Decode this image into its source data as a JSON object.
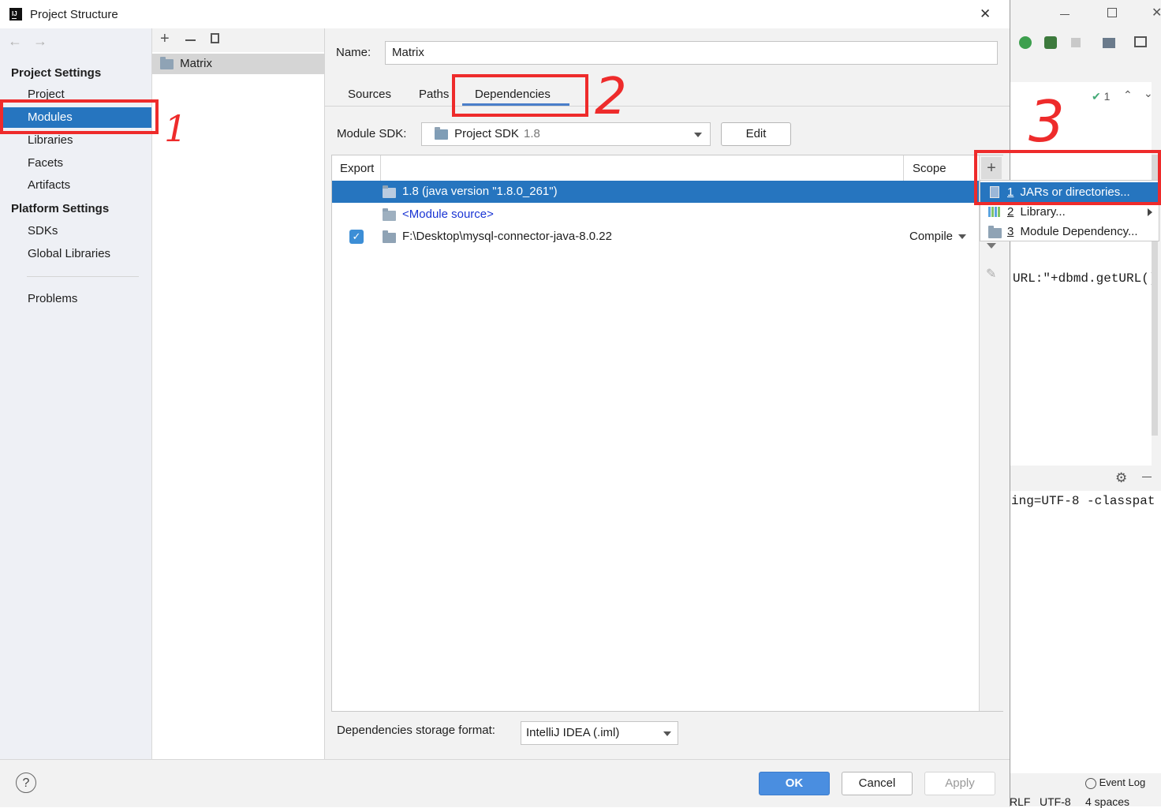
{
  "dialog": {
    "title": "Project Structure",
    "close_glyph": "✕"
  },
  "sidebar": {
    "project_settings_heading": "Project Settings",
    "project_settings_items": [
      "Project",
      "Modules",
      "Libraries",
      "Facets",
      "Artifacts"
    ],
    "platform_settings_heading": "Platform Settings",
    "platform_settings_items": [
      "SDKs",
      "Global Libraries"
    ],
    "problems": "Problems"
  },
  "modules_panel": {
    "module_name": "Matrix"
  },
  "main": {
    "name_label": "Name:",
    "name_value": "Matrix",
    "tabs": [
      "Sources",
      "Paths",
      "Dependencies"
    ],
    "module_sdk_label": "Module SDK:",
    "module_sdk_value": "Project SDK",
    "module_sdk_version": "1.8",
    "edit_button": "Edit",
    "table_headers": {
      "export": "Export",
      "scope": "Scope"
    },
    "rows": [
      {
        "name": "1.8 (java version \"1.8.0_261\")",
        "scope": ""
      },
      {
        "name": "<Module source>",
        "scope": ""
      },
      {
        "name": "F:\\Desktop\\mysql-connector-java-8.0.22",
        "scope": "Compile"
      }
    ],
    "storage_label": "Dependencies storage format:",
    "storage_value": "IntelliJ IDEA (.iml)"
  },
  "add_menu": {
    "items": [
      {
        "number": "1",
        "label": "JARs or directories..."
      },
      {
        "number": "2",
        "label": "Library..."
      },
      {
        "number": "3",
        "label": "Module Dependency..."
      }
    ]
  },
  "footer": {
    "help": "?",
    "ok": "OK",
    "cancel": "Cancel",
    "apply": "Apply"
  },
  "background_ide": {
    "problems_count": "1",
    "code_line": "URL:\"+dbmd.getURL()",
    "terminal_line": "ing=UTF-8 -classpat",
    "event_log": "Event Log",
    "status_line_sep": "RLF",
    "status_encoding": "UTF-8",
    "status_indent": "4 spaces"
  },
  "annotations": {
    "marker_1": "1",
    "marker_2": "2",
    "marker_3": "3"
  },
  "colors": {
    "selection": "#2675bf",
    "annotation_red": "#ee2b2b",
    "ok_button": "#4a8ee0"
  }
}
